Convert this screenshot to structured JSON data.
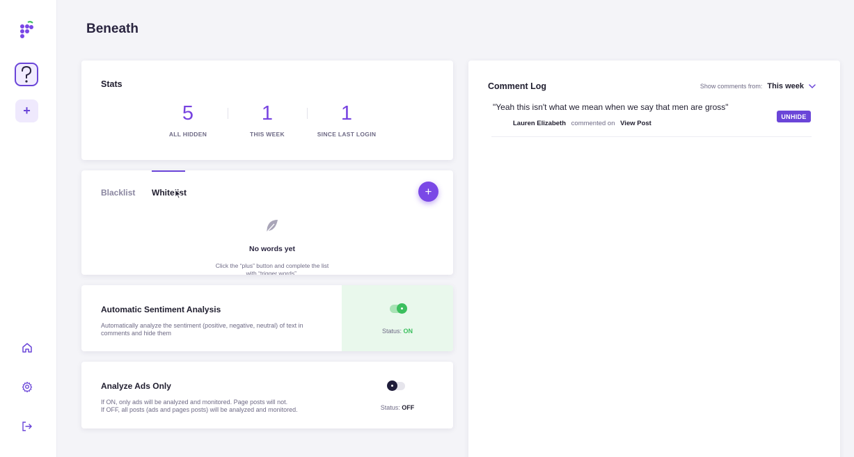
{
  "page": {
    "title": "Beneath"
  },
  "sidebar": {
    "logo_icon": "grapes-logo",
    "help_icon": "question-mark-icon",
    "add_label": "+",
    "nav": [
      {
        "icon": "home-icon"
      },
      {
        "icon": "gear-icon"
      },
      {
        "icon": "logout-icon"
      }
    ]
  },
  "stats": {
    "heading": "Stats",
    "items": [
      {
        "value": "5",
        "label": "ALL HIDDEN"
      },
      {
        "value": "1",
        "label": "THIS WEEK"
      },
      {
        "value": "1",
        "label": "SINCE LAST LOGIN"
      }
    ]
  },
  "word_lists": {
    "tabs": [
      {
        "label": "Blacklist",
        "active": false
      },
      {
        "label": "Whitelist",
        "active": true
      }
    ],
    "add_button": "+",
    "empty_title": "No words yet",
    "empty_help": "Click the “plus” button and complete the list with “trigger words”."
  },
  "sentiment": {
    "title": "Automatic Sentiment Analysis",
    "description": "Automatically analyze the sentiment (positive, negative, neutral) of text in comments and hide them",
    "status_label": "Status:",
    "status_value": "ON",
    "enabled": true
  },
  "ads_only": {
    "title": "Analyze Ads Only",
    "description_line1": "If ON, only ads will be analyzed and monitored. Page posts will not.",
    "description_line2": "If OFF, all posts (ads and pages posts) will be analyzed and monitored.",
    "status_label": "Status:",
    "status_value": "OFF",
    "enabled": false
  },
  "comment_log": {
    "heading": "Comment Log",
    "filter_label": "Show comments from:",
    "filter_value": "This week",
    "comments": [
      {
        "text": "\"Yeah this isn't what we mean when we say that men are gross\"",
        "author": "Lauren Elizabeth",
        "verb": "commented on",
        "link": "View Post",
        "action": "UNHIDE"
      }
    ]
  },
  "colors": {
    "accent": "#6a45d8",
    "stat_value": "#7743e0",
    "on_green": "#3bbf5e",
    "off_dark": "#1f1d3a",
    "sentiment_bg": "#e9f8ec"
  }
}
